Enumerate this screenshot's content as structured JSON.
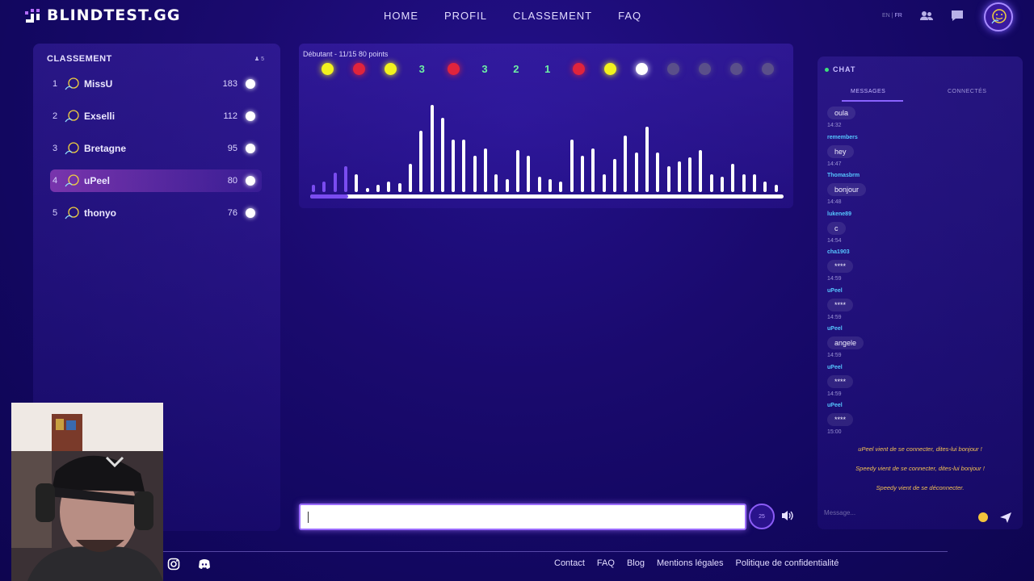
{
  "header": {
    "logo_text": "BLINDTEST.GG",
    "nav": [
      "HOME",
      "PROFIL",
      "CLASSEMENT",
      "FAQ"
    ],
    "lang": {
      "en": "EN",
      "sep": "|",
      "fr": "FR"
    }
  },
  "leaderboard": {
    "title": "CLASSEMENT",
    "player_count": "5",
    "rows": [
      {
        "rank": "1",
        "name": "MissU",
        "score": "183",
        "highlight": false
      },
      {
        "rank": "2",
        "name": "Exselli",
        "score": "112",
        "highlight": false
      },
      {
        "rank": "3",
        "name": "Bretagne",
        "score": "95",
        "highlight": false
      },
      {
        "rank": "4",
        "name": "uPeel",
        "score": "80",
        "highlight": true
      },
      {
        "rank": "5",
        "name": "thonyo",
        "score": "76",
        "highlight": false
      }
    ]
  },
  "game": {
    "status": "Débutant - 11/15   80 points",
    "rounds": [
      {
        "type": "dot",
        "color": "#f2f21e"
      },
      {
        "type": "dot",
        "color": "#e0243c"
      },
      {
        "type": "dot",
        "color": "#f2f21e"
      },
      {
        "type": "num",
        "value": "3"
      },
      {
        "type": "dot",
        "color": "#e0243c"
      },
      {
        "type": "num",
        "value": "3"
      },
      {
        "type": "num",
        "value": "2"
      },
      {
        "type": "num",
        "value": "1"
      },
      {
        "type": "dot",
        "color": "#e0243c"
      },
      {
        "type": "dot",
        "color": "#f2f21e"
      },
      {
        "type": "dot",
        "color": "#ffffff"
      },
      {
        "type": "dot",
        "color": "#5a4f8a"
      },
      {
        "type": "dot",
        "color": "#5a4f8a"
      },
      {
        "type": "dot",
        "color": "#5a4f8a"
      },
      {
        "type": "dot",
        "color": "#5a4f8a"
      }
    ],
    "visualizer_levels": [
      0.08,
      0.12,
      0.22,
      0.3,
      0.2,
      0.05,
      0.08,
      0.12,
      0.1,
      0.32,
      0.7,
      1.0,
      0.85,
      0.6,
      0.6,
      0.42,
      0.5,
      0.2,
      0.15,
      0.48,
      0.42,
      0.18,
      0.15,
      0.12,
      0.6,
      0.42,
      0.5,
      0.2,
      0.38,
      0.65,
      0.45,
      0.75,
      0.45,
      0.3,
      0.35,
      0.4,
      0.48,
      0.2,
      0.18,
      0.32,
      0.2,
      0.2,
      0.12,
      0.08
    ],
    "purple_bar_count": 4,
    "progress": 0.08,
    "timer": "25"
  },
  "chat": {
    "title": "CHAT",
    "tab_messages": "MESSAGES",
    "tab_connected": "CONNECTÉS",
    "messages": [
      {
        "user": "",
        "text": "oula",
        "time": "14:32"
      },
      {
        "user": "remembers",
        "text": "hey",
        "time": "14:47"
      },
      {
        "user": "Thomasbrm",
        "text": "bonjour",
        "time": "14:48"
      },
      {
        "user": "lukene89",
        "text": "c",
        "time": "14:54"
      },
      {
        "user": "cha1903",
        "text": "****",
        "time": "14:59"
      },
      {
        "user": "uPeel",
        "text": "****",
        "time": "14:59"
      },
      {
        "user": "uPeel",
        "text": "angele",
        "time": "14:59"
      },
      {
        "user": "uPeel",
        "text": "****",
        "time": "14:59"
      },
      {
        "user": "uPeel",
        "text": "****",
        "time": "15:00"
      }
    ],
    "system": [
      "uPeel vient de se connecter, dites-lui bonjour !",
      "Speedy vient de se connecter, dites-lui bonjour !",
      "Speedy vient de se déconnecter."
    ],
    "input_placeholder": "Message..."
  },
  "footer": {
    "links": [
      "Contact",
      "FAQ",
      "Blog",
      "Mentions légales",
      "Politique de confidentialité"
    ]
  },
  "colors": {
    "accent": "#8a63ff",
    "correct": "#6ef0a4",
    "system_msg": "#f6c453",
    "username": "#56c6ff"
  }
}
